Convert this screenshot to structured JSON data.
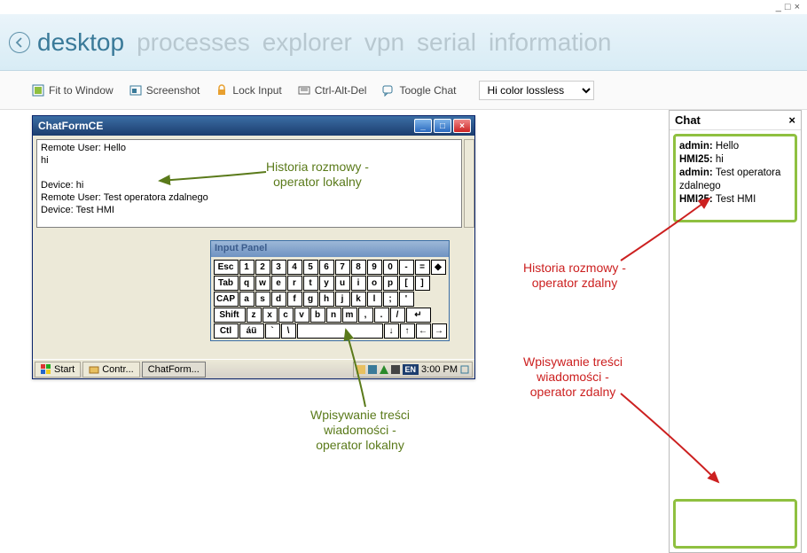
{
  "window_controls": {
    "min": "_",
    "max": "□",
    "close": "×"
  },
  "nav": {
    "tabs": [
      {
        "label": "desktop",
        "active": true
      },
      {
        "label": "processes",
        "active": false
      },
      {
        "label": "explorer",
        "active": false
      },
      {
        "label": "vpn",
        "active": false
      },
      {
        "label": "serial",
        "active": false
      },
      {
        "label": "information",
        "active": false
      }
    ]
  },
  "toolbar": {
    "fit": "Fit to Window",
    "screenshot": "Screenshot",
    "lock": "Lock Input",
    "cad": "Ctrl-Alt-Del",
    "chat": "Toogle Chat",
    "quality_selected": "Hi color lossless"
  },
  "remote": {
    "title": "ChatFormCE",
    "chat_lines": "Remote User: Hello\nhi\n\nDevice: hi\nRemote User: Test operatora zdalnego\nDevice: Test HMI",
    "input_panel_title": "Input Panel",
    "taskbar": {
      "start": "Start",
      "task1": "Contr...",
      "task2": "ChatForm...",
      "lang": "EN",
      "time": "3:00 PM"
    },
    "keys": {
      "row1": [
        "Esc",
        "1",
        "2",
        "3",
        "4",
        "5",
        "6",
        "7",
        "8",
        "9",
        "0",
        "-",
        "=",
        "◆"
      ],
      "row2": [
        "Tab",
        "q",
        "w",
        "e",
        "r",
        "t",
        "y",
        "u",
        "i",
        "o",
        "p",
        "[",
        "]"
      ],
      "row3": [
        "CAP",
        "a",
        "s",
        "d",
        "f",
        "g",
        "h",
        "j",
        "k",
        "l",
        ";",
        "'"
      ],
      "row4": [
        "Shift",
        "z",
        "x",
        "c",
        "v",
        "b",
        "n",
        "m",
        ",",
        ".",
        "/",
        "↵"
      ],
      "row5": [
        "Ctl",
        "áü",
        "`",
        "\\",
        " ",
        "↓",
        "↑",
        "←",
        "→"
      ]
    }
  },
  "chat": {
    "title": "Chat",
    "messages": [
      {
        "user": "admin",
        "text": "Hello"
      },
      {
        "user": "HMI25",
        "text": "hi"
      },
      {
        "user": "admin",
        "text": "Test operatora zdalnego"
      },
      {
        "user": "HMI25",
        "text": "Test HMI"
      }
    ]
  },
  "annotations": {
    "a1": "Historia rozmowy -\noperator lokalny",
    "a2": "Wpisywanie treści\nwiadomości -\noperator lokalny",
    "a3": "Historia rozmowy -\noperator zdalny",
    "a4": "Wpisywanie treści\nwiadomości -\noperator zdalny"
  }
}
